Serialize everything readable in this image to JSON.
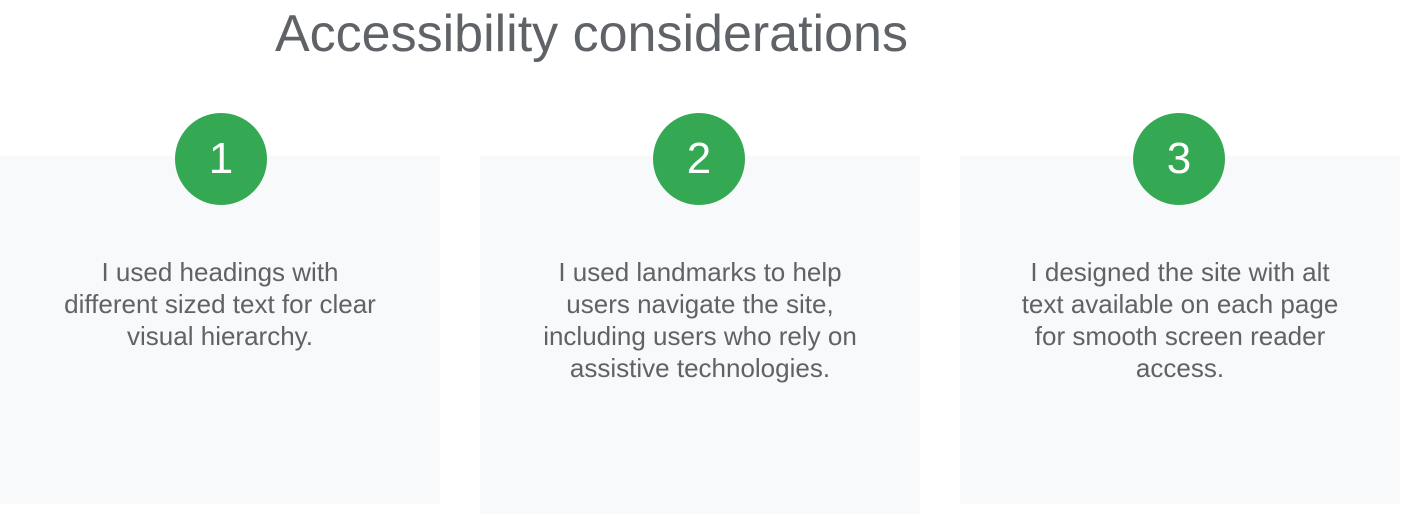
{
  "title": "Accessibility considerations",
  "cards": [
    {
      "number": "1",
      "text": "I used headings with different sized text for clear visual hierarchy."
    },
    {
      "number": "2",
      "text": "I used landmarks to help users navigate the site, including users who rely on assistive technologies."
    },
    {
      "number": "3",
      "text": "I designed the site with alt text available on each page for smooth screen reader access."
    }
  ],
  "colors": {
    "accent": "#34a853",
    "card_background": "#f8f9fa",
    "text": "#5f6368"
  }
}
